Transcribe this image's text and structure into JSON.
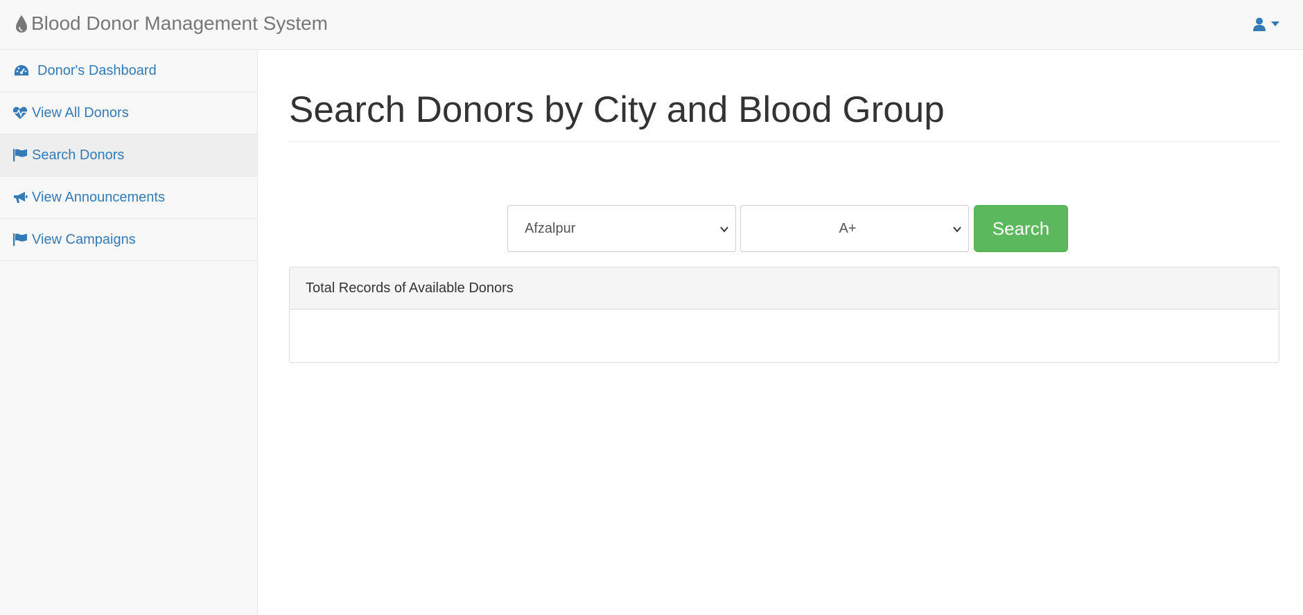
{
  "app": {
    "brand": "Blood Donor Management System"
  },
  "sidebar": {
    "items": [
      {
        "label": "Donor's Dashboard",
        "icon": "dashboard-icon"
      },
      {
        "label": "View All Donors",
        "icon": "heartbeat-icon"
      },
      {
        "label": "Search Donors",
        "icon": "flag-icon",
        "active": true
      },
      {
        "label": "View Announcements",
        "icon": "bullhorn-icon"
      },
      {
        "label": "View Campaigns",
        "icon": "flag-icon"
      }
    ]
  },
  "main": {
    "title": "Search Donors by City and Blood Group",
    "city_select": {
      "value": "Afzalpur"
    },
    "blood_group_select": {
      "value": "A+"
    },
    "search_button": "Search",
    "panel": {
      "heading": "Total Records of Available Donors"
    }
  },
  "colors": {
    "link": "#337ab7",
    "success": "#5cb85c",
    "navbar_bg": "#f8f8f8"
  }
}
